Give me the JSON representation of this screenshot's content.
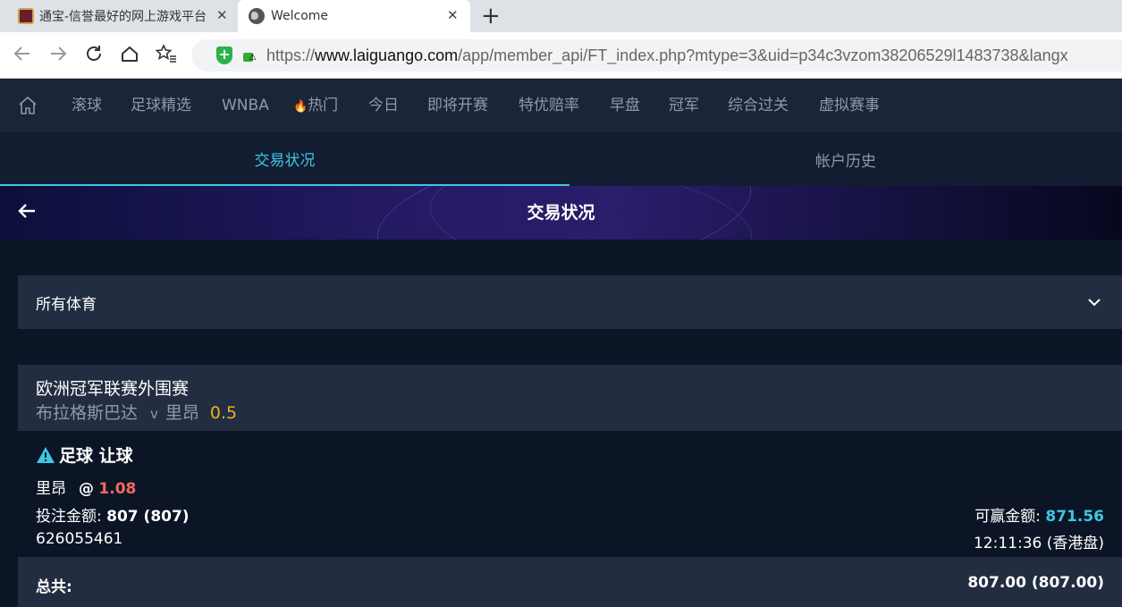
{
  "browser": {
    "tabs": [
      {
        "title": "通宝-信誉最好的网上游戏平台"
      },
      {
        "title": "Welcome"
      }
    ],
    "close_glyph": "✕",
    "new_tab_glyph": "+",
    "url_prefix": "https://",
    "url_domain": "www.laiguango.com",
    "url_path": "/app/member_api/FT_index.php?mtype=3&uid=p34c3vzom38206529l1483738&langx",
    "icons": {
      "back": "arrow-left-icon",
      "forward": "arrow-right-icon",
      "reload": "reload-icon",
      "home": "home-icon",
      "bookmarks": "star-list-icon",
      "shield": "shield-icon",
      "lock": "not-secure-lock-icon"
    }
  },
  "site_nav": {
    "items": [
      "滚球",
      "足球精选",
      "WNBA",
      "热门",
      "今日",
      "即将开赛",
      "特优赔率",
      "早盘",
      "冠军",
      "综合过关",
      "虚拟赛事"
    ],
    "hot_icon": "🔥"
  },
  "sub_tabs": {
    "active": "交易状况",
    "inactive": "帐户历史"
  },
  "banner": {
    "title": "交易状况"
  },
  "filter": {
    "selected": "所有体育"
  },
  "bet": {
    "league": "欧洲冠军联赛外围赛",
    "home_team": "布拉格斯巴达",
    "vs": "v",
    "away_team": "里昂",
    "handicap": "0.5",
    "bet_type": "足球 让球",
    "selection": "里昂",
    "at_symbol": "@",
    "odds": "1.08",
    "stake_label": "投注金额:",
    "stake_value": "807 (807)",
    "towin_label": "可赢金额:",
    "towin_value": "871.56",
    "ticket_id": "626055461",
    "time": "12:11:36 (香港盘)"
  },
  "total": {
    "label": "总共:",
    "value": "807.00 (807.00)"
  },
  "colors": {
    "page_bg": "#0c1526",
    "nav_bg": "#1b2538",
    "panel_bg": "#222d42",
    "accent_cyan": "#3fc6e2",
    "odds_red": "#f06b5e",
    "handicap_gold": "#f0b020"
  }
}
